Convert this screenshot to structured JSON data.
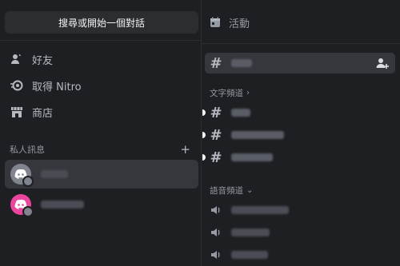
{
  "search": {
    "label": "搜尋或開始一個對話"
  },
  "nav": [
    {
      "label": "好友",
      "icon": "friends-icon"
    },
    {
      "label": "取得 Nitro",
      "icon": "nitro-icon"
    },
    {
      "label": "商店",
      "icon": "shop-icon"
    }
  ],
  "dm": {
    "header": "私人訊息",
    "add_icon": "plus-icon",
    "items": [
      {
        "avatar_color": "#80848e",
        "active": true,
        "status": "offline"
      },
      {
        "avatar_color": "#eb459e",
        "active": false,
        "status": "offline"
      }
    ]
  },
  "server": {
    "events_label": "活動",
    "events_icon": "calendar-icon",
    "text_category": "文字頻道",
    "voice_category": "語音頻道",
    "text_channels": [
      {
        "selected": true
      },
      {
        "selected": false
      },
      {
        "selected": false
      },
      {
        "selected": false
      }
    ],
    "voice_channels": [
      {},
      {},
      {}
    ]
  },
  "colors": {
    "background": "#1e1f22",
    "surface": "#2b2d31",
    "selected": "#35373c",
    "text_muted": "#949ba4",
    "text_primary": "#f2f3f5",
    "avatar_pink": "#eb459e",
    "avatar_gray": "#80848e"
  }
}
